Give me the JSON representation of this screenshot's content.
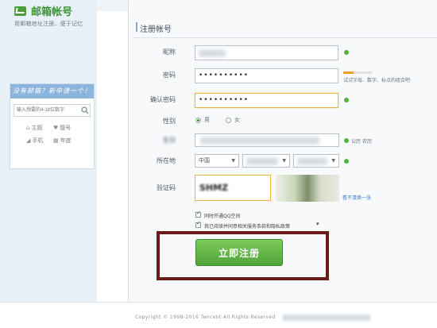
{
  "app": {
    "title": "邮箱帐号",
    "subtitle": "用邮箱地址注册，便于记忆"
  },
  "sidebar": {
    "panel_title": "没有邮箱？新申请一个！",
    "search_placeholder": "输入想要的4-18位数字",
    "links": [
      {
        "icon": "house-icon",
        "label": "主题"
      },
      {
        "icon": "heart-icon",
        "label": "靓号"
      },
      {
        "icon": "signal-icon",
        "label": "手机"
      },
      {
        "icon": "calendar-icon",
        "label": "年度"
      }
    ]
  },
  "form": {
    "section_title": "注册帐号",
    "nickname": {
      "label": "昵称",
      "value": ""
    },
    "password": {
      "label": "密码",
      "value": "••••••••••",
      "strength": 0.35,
      "strength_hint": "试试字母、数字、标点的组合吧"
    },
    "confirm_password": {
      "label": "确认密码",
      "value": "••••••••••"
    },
    "gender": {
      "label": "性别",
      "options": [
        "男",
        "女"
      ],
      "selected": "男"
    },
    "birthday": {
      "label": "生日",
      "calendar_options": [
        "公历",
        "农历"
      ]
    },
    "location": {
      "label": "所在地",
      "country": "中国",
      "province": "",
      "city": ""
    },
    "captcha": {
      "label": "验证码",
      "value": "SHMZ",
      "refresh_link": "看不清换一张"
    },
    "checkbox_qzone": "同时开通QQ空间",
    "checkbox_terms": "我已阅读并同意相关服务条款和隐私政策",
    "submit_label": "立即注册"
  },
  "footer": {
    "copyright": "Copyright © 1998-2016 Tencent All Rights Reserved"
  },
  "colors": {
    "brand_green": "#3a9236",
    "button_green": "#5cb342",
    "highlight_border": "#6b1a1a",
    "panel_blue": "#8db4dc"
  }
}
